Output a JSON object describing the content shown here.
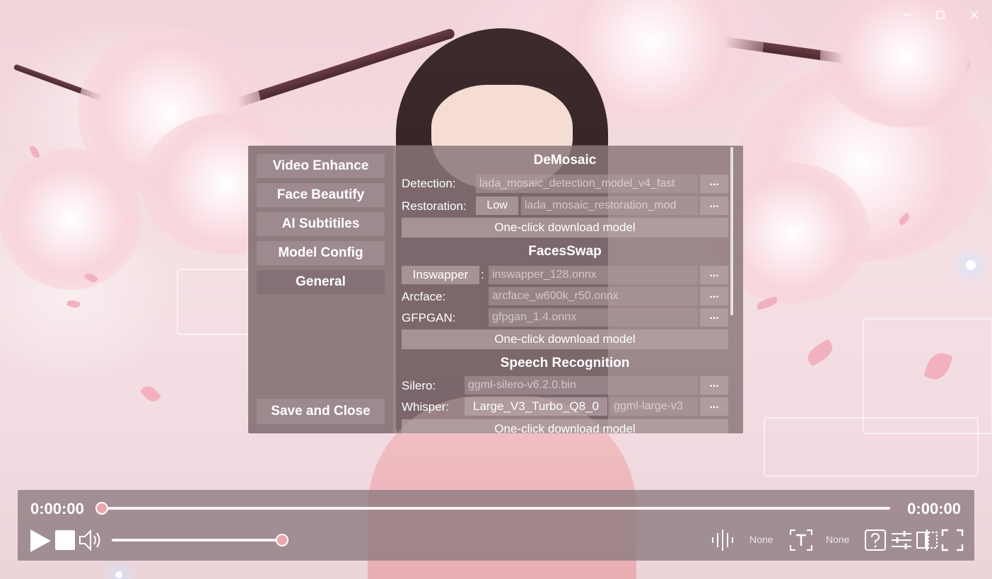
{
  "dialog": {
    "nav": {
      "video_enhance": "Video Enhance",
      "face_beautify": "Face Beautify",
      "ai_subtitles": "AI Subtitiles",
      "model_config": "Model Config",
      "general": "General",
      "save_close": "Save and Close"
    },
    "demosaic": {
      "title": "DeMosaic",
      "detection_label": "Detection:",
      "detection_value": "lada_mosaic_detection_model_v4_fast",
      "restoration_label": "Restoration:",
      "restoration_quality": "Low",
      "restoration_value": "lada_mosaic_restoration_mod",
      "download": "One-click download model"
    },
    "faceswap": {
      "title": "FacesSwap",
      "inswapper_btn": "Inswapper",
      "colon": ":",
      "inswapper_value": "inswapper_128.onnx",
      "arcface_label": "Arcface:",
      "arcface_value": "arcface_w600k_r50.onnx",
      "gfpgan_label": "GFPGAN:",
      "gfpgan_value": "gfpgan_1.4.onnx",
      "download": "One-click download model"
    },
    "speech": {
      "title": "Speech Recognition",
      "silero_label": "Silero:",
      "silero_value": "ggml-silero-v6.2.0.bin",
      "whisper_label": "Whisper:",
      "whisper_model": "Large_V3_Turbo_Q8_0",
      "whisper_value": "ggml-large-v3",
      "download": "One-click download model"
    },
    "browse": "..."
  },
  "player": {
    "current_time": "0:00:00",
    "total_time": "0:00:00",
    "progress": 0,
    "volume": 1.0,
    "audio_track": "None",
    "subtitle_track": "None"
  },
  "icons": [
    "minimize-icon",
    "maximize-icon",
    "close-icon",
    "play-icon",
    "stop-icon",
    "volume-icon",
    "audio-wave-icon",
    "subtitle-icon",
    "help-icon",
    "settings-sliders-icon",
    "compare-icon",
    "fullscreen-icon"
  ],
  "colors": {
    "accent": "#e8a8ae",
    "panel": "#8a767a"
  }
}
